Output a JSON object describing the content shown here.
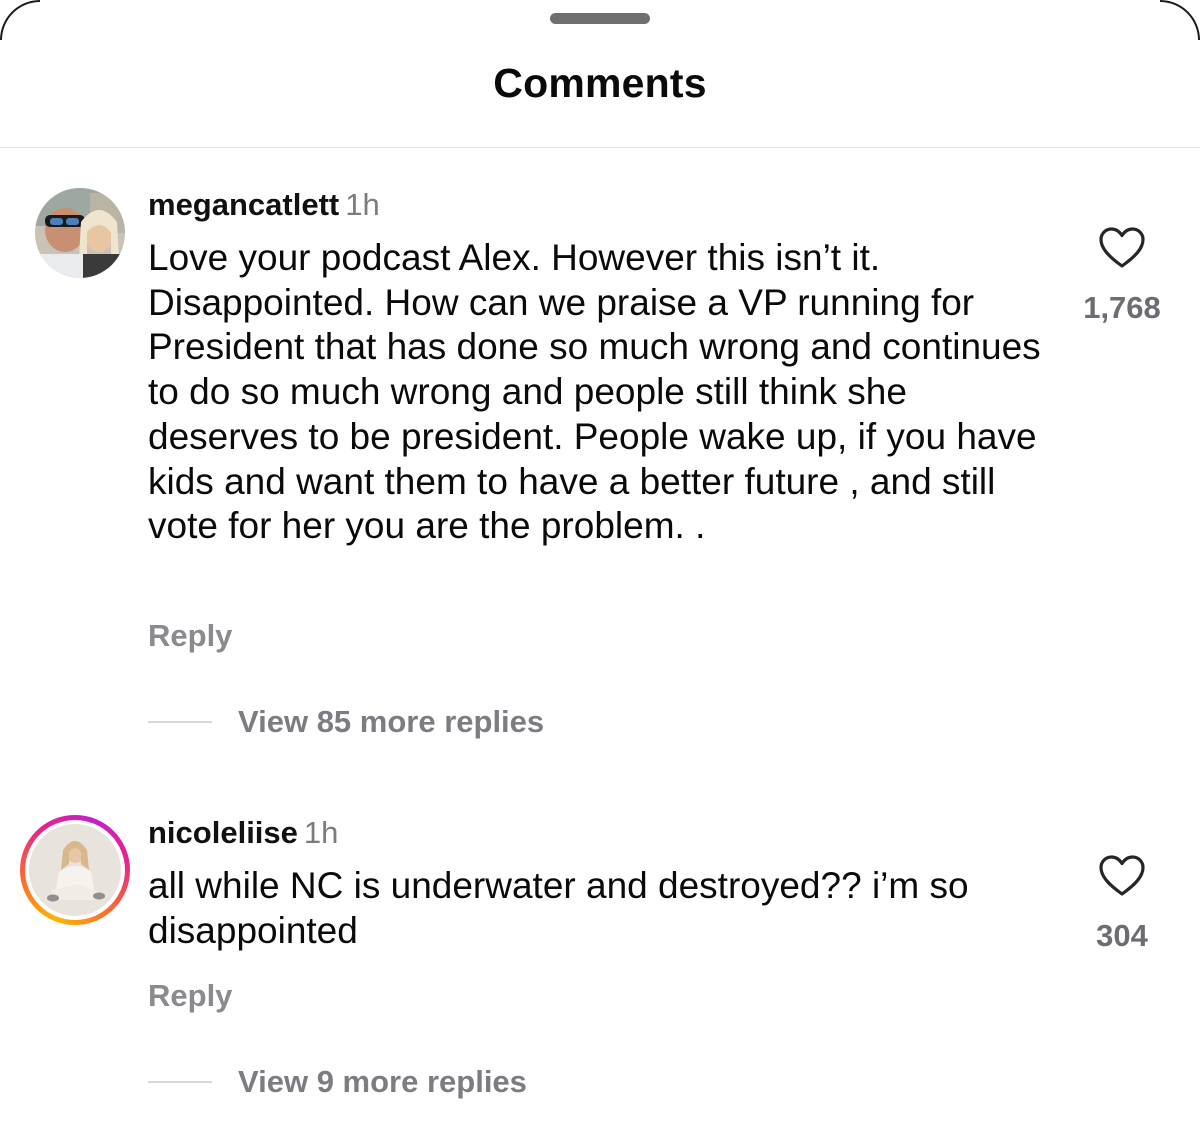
{
  "sheet": {
    "title": "Comments"
  },
  "comments": [
    {
      "username": "megancatlett",
      "time": "1h",
      "text": "Love your podcast Alex. However this isn’t it. Disappointed.  How can we praise a VP running for President that has done so much wrong and continues to do so much wrong and people still think she deserves to be president. People wake up, if you have kids and want them to have a better future , and  still vote for her you are the problem. .",
      "like_icon": "heart-outline-icon",
      "likes": "1,768",
      "reply_label": "Reply",
      "view_replies_label": "View 85 more replies",
      "avatar_has_story_ring": false
    },
    {
      "username": "nicoleliise",
      "time": "1h",
      "text": "all while NC is underwater and destroyed?? i’m so disappointed",
      "like_icon": "heart-outline-icon",
      "likes": "304",
      "reply_label": "Reply",
      "view_replies_label": "View 9 more replies",
      "avatar_has_story_ring": true
    }
  ],
  "colors": {
    "story_ring": [
      "#f9b700",
      "#ff6b2c",
      "#e8238a",
      "#c21fd0"
    ],
    "secondary_text": "#7b7b80",
    "divider": "#e3e3e6"
  }
}
